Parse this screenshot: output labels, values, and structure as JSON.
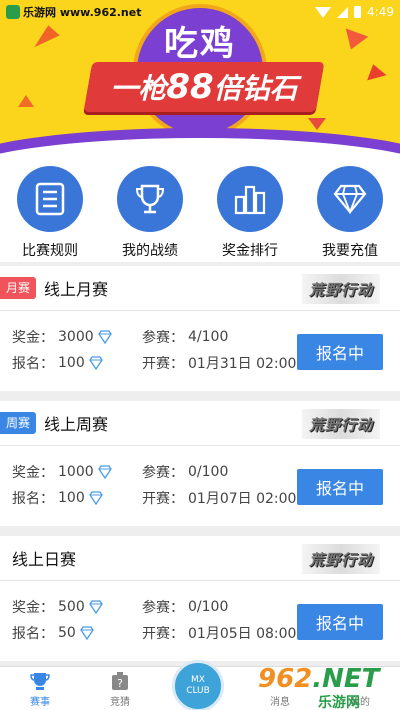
{
  "statusbar": {
    "watermark": "乐游网 www.962.net",
    "time": "4:49"
  },
  "banner": {
    "title_top": "吃鸡",
    "ribbon_prefix": "一枪",
    "ribbon_num": "88",
    "ribbon_suffix": "倍钻石"
  },
  "quick_links": [
    {
      "label": "比赛规则",
      "icon": "rules-document-icon"
    },
    {
      "label": "我的战绩",
      "icon": "trophy-icon"
    },
    {
      "label": "奖金排行",
      "icon": "bar-ranking-icon"
    },
    {
      "label": "我要充值",
      "icon": "diamond-icon"
    }
  ],
  "cards": [
    {
      "tag": "月赛",
      "tag_color": "#f0545a",
      "name": "线上月赛",
      "logo": "荒野行动",
      "prize_label": "奖金：",
      "prize": "3000",
      "fee_label": "报名：",
      "fee": "100",
      "players_label": "参赛：",
      "players": "4/100",
      "start_label": "开赛：",
      "start": "01月31日 02:00",
      "button": "报名中"
    },
    {
      "tag": "周赛",
      "tag_color": "#3a86e4",
      "name": "线上周赛",
      "logo": "荒野行动",
      "prize_label": "奖金：",
      "prize": "1000",
      "fee_label": "报名：",
      "fee": "100",
      "players_label": "参赛：",
      "players": "0/100",
      "start_label": "开赛：",
      "start": "01月07日 02:00",
      "button": "报名中"
    },
    {
      "tag": "",
      "name": "线上日赛",
      "logo": "荒野行动",
      "prize_label": "奖金：",
      "prize": "500",
      "fee_label": "报名：",
      "fee": "50",
      "players_label": "参赛：",
      "players": "0/100",
      "start_label": "开赛：",
      "start": "01月05日 08:00",
      "button": "报名中"
    }
  ],
  "tabbar": {
    "tabs": [
      {
        "label": "赛事",
        "icon": "trophy-tab-icon",
        "active": true
      },
      {
        "label": "竞猜",
        "icon": "quiz-bag-icon",
        "active": false
      },
      {
        "label": "",
        "icon": "club-icon",
        "active": false
      },
      {
        "label": "消息",
        "icon": "message-icon",
        "active": false
      },
      {
        "label": "我的",
        "icon": "profile-icon",
        "active": false
      }
    ],
    "club_line1": "MX",
    "club_line2": "CLUB"
  },
  "watermark2": {
    "brand_a": "962",
    "brand_b": ".NET",
    "brand_cn": "乐游网"
  },
  "colors": {
    "accent": "#3a86e4",
    "banner_bg": "#fbd51c",
    "ribbon": "#e03a3a"
  }
}
